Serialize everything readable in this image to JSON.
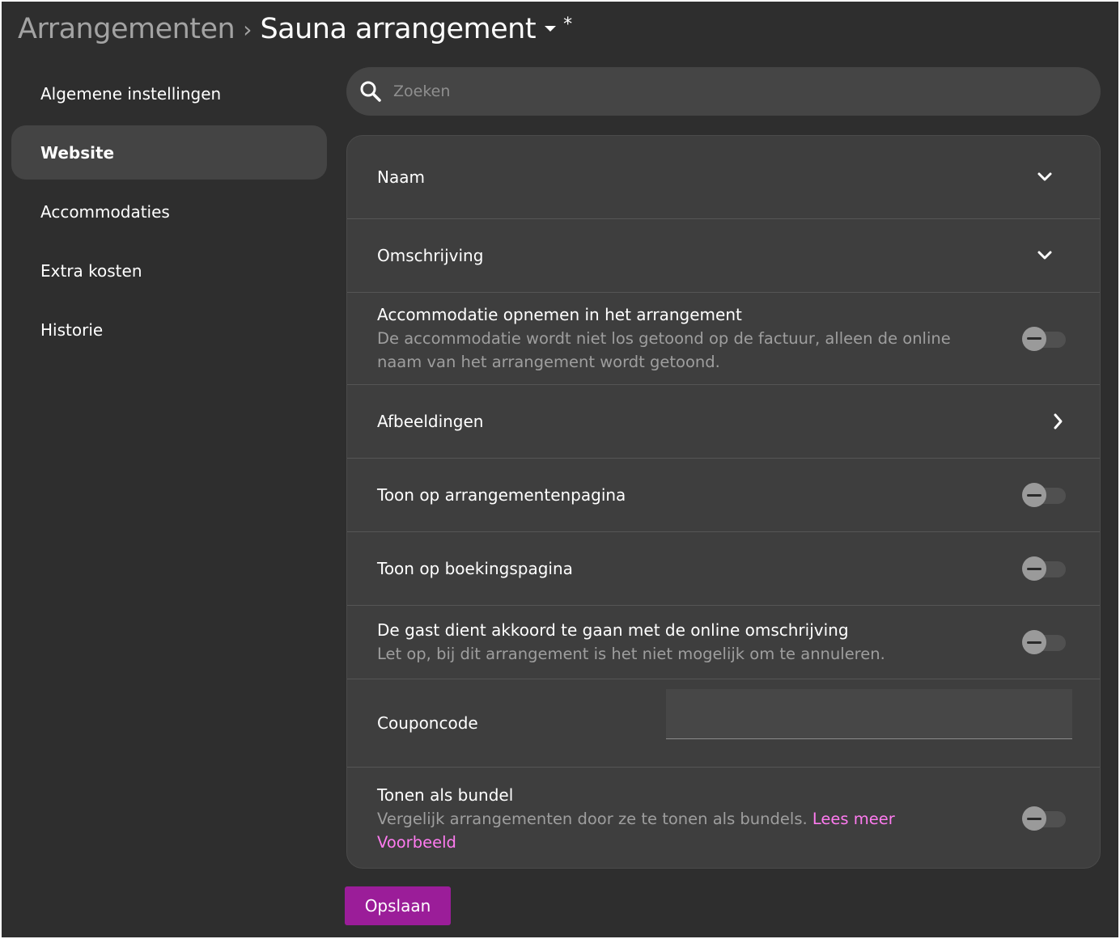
{
  "header": {
    "parent": "Arrangementen",
    "separator": "›",
    "current": "Sauna arrangement",
    "unsaved_marker": "*"
  },
  "sidebar": {
    "items": [
      {
        "label": "Algemene instellingen",
        "active": false
      },
      {
        "label": "Website",
        "active": true
      },
      {
        "label": "Accommodaties",
        "active": false
      },
      {
        "label": "Extra kosten",
        "active": false
      },
      {
        "label": "Historie",
        "active": false
      }
    ]
  },
  "search": {
    "placeholder": "Zoeken",
    "value": "",
    "icon": "search-icon"
  },
  "settings": {
    "naam": {
      "title": "Naam",
      "icon": "chevron-down-icon"
    },
    "omschrijving": {
      "title": "Omschrijving",
      "icon": "chevron-down-icon"
    },
    "accommodatie": {
      "title": "Accommodatie opnemen in het arrangement",
      "description": "De accommodatie wordt niet los getoond op de factuur, alleen de online naam van het arrangement wordt getoond.",
      "enabled": false
    },
    "afbeeldingen": {
      "title": "Afbeeldingen",
      "icon": "chevron-right-icon"
    },
    "toon_arrangementen": {
      "title": "Toon op arrangementenpagina",
      "enabled": false
    },
    "toon_boeking": {
      "title": "Toon op boekingspagina",
      "enabled": false
    },
    "akkoord": {
      "title": "De gast dient akkoord te gaan met de online omschrijving",
      "description": "Let op, bij dit arrangement is het niet mogelijk om te annuleren.",
      "enabled": false
    },
    "coupon": {
      "title": "Couponcode",
      "value": ""
    },
    "bundel": {
      "title": "Tonen als bundel",
      "description": "Vergelijk arrangementen door ze te tonen als bundels.",
      "link_read_more": "Lees meer",
      "link_example": "Voorbeeld",
      "enabled": false
    }
  },
  "actions": {
    "save_label": "Opslaan"
  },
  "colors": {
    "background": "#2e2e2e",
    "card": "#3e3e3e",
    "accent_button": "#9b1d99",
    "link": "#ff7bf0",
    "muted_text": "#9e9e9e"
  }
}
